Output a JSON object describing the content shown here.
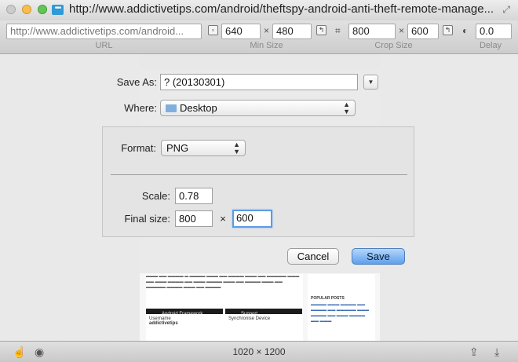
{
  "window": {
    "title": "http://www.addictivetips.com/android/theftspy-android-anti-theft-remote-manage..."
  },
  "toolbar": {
    "url_value": "http://www.addictivetips.com/android...",
    "url_label": "URL",
    "min_width": "640",
    "min_height": "480",
    "min_size_label": "Min Size",
    "crop_width": "800",
    "crop_height": "600",
    "crop_size_label": "Crop Size",
    "delay": "0.0",
    "delay_label": "Delay",
    "times": "×"
  },
  "dialog": {
    "save_as_label": "Save As:",
    "save_as_value": "? (20130301)",
    "where_label": "Where:",
    "where_value": "Desktop",
    "format_label": "Format:",
    "format_value": "PNG",
    "scale_label": "Scale:",
    "scale_value": "0.78",
    "final_size_label": "Final size:",
    "final_width": "800",
    "final_height": "600",
    "times": "×",
    "cancel": "Cancel",
    "save": "Save"
  },
  "preview": {
    "android_framework": "Android Framework",
    "support": "Support",
    "username_label": "Username",
    "username_value": "addictivetips",
    "synchronise": "Synchronise Device",
    "popular_posts": "POPULAR POSTS"
  },
  "bottombar": {
    "dimensions": "1020 × 1200"
  }
}
